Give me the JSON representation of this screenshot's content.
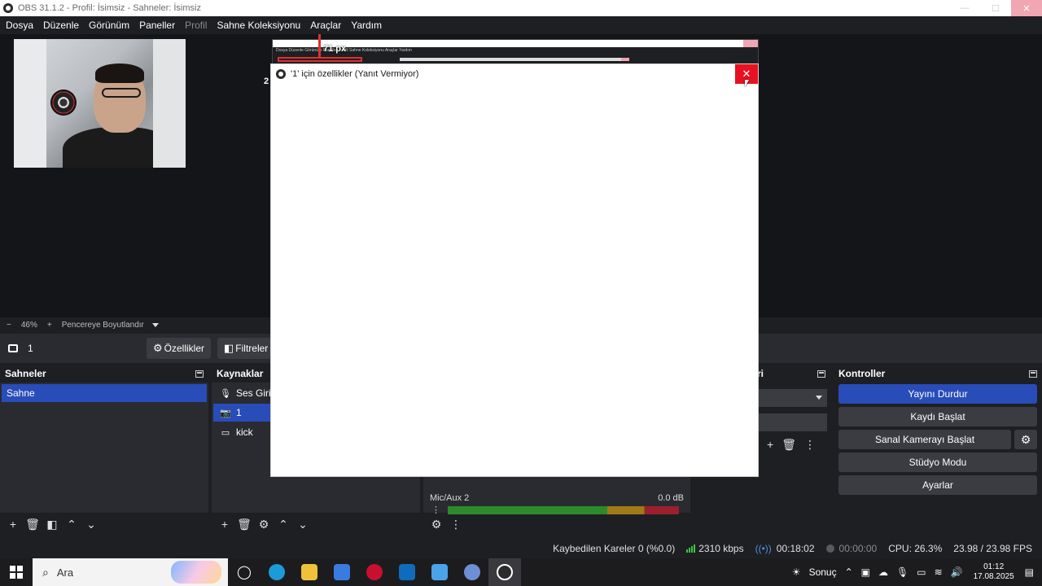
{
  "window": {
    "title": "OBS 31.1.2 - Profil: İsimsiz - Sahneler: İsimsiz"
  },
  "menu": {
    "items": [
      {
        "label": "Dosya"
      },
      {
        "label": "Düzenle"
      },
      {
        "label": "Görünüm"
      },
      {
        "label": "Paneller"
      },
      {
        "label": "Profil",
        "disabled": true
      },
      {
        "label": "Sahne Koleksiyonu"
      },
      {
        "label": "Araçlar"
      },
      {
        "label": "Yardım"
      }
    ]
  },
  "preview": {
    "measure_label": "71 px",
    "side_label": "2",
    "nested_menu": "Dosya   Düzenle   Görünüm   Paneller   Profil   Sahne Koleksiyonu   Araçlar   Yardım"
  },
  "zoom": {
    "minus": "−",
    "value": "46%",
    "plus": "+",
    "fit_label": "Pencereye Boyutlandır"
  },
  "context": {
    "source_name": "1",
    "properties_label": "Özellikler",
    "filters_label": "Filtreler"
  },
  "scenes": {
    "title": "Sahneler",
    "items": [
      "Sahne"
    ]
  },
  "sources": {
    "title": "Kaynaklar",
    "items": [
      {
        "label": "Ses Girişi",
        "icon": "microphone-icon"
      },
      {
        "label": "1",
        "icon": "camera-icon"
      },
      {
        "label": "kick",
        "icon": "monitor-icon"
      }
    ]
  },
  "mixer": {
    "track2_name": "Mic/Aux 2",
    "track2_db": "0.0 dB"
  },
  "transitions": {
    "title_fragment": "ri"
  },
  "controls": {
    "title": "Kontroller",
    "stop_stream": "Yayını Durdur",
    "start_record": "Kaydı Başlat",
    "start_virtualcam": "Sanal Kamerayı Başlat",
    "studio_mode": "Stüdyo Modu",
    "settings": "Ayarlar"
  },
  "status": {
    "dropped_frames": "Kaybedilen Kareler 0 (%0.0)",
    "bitrate": "2310 kbps",
    "stream_time": "00:18:02",
    "record_time": "00:00:00",
    "cpu": "CPU: 26.3%",
    "fps": "23.98 / 23.98 FPS"
  },
  "taskbar": {
    "search_placeholder": "Ara",
    "tray_label": "Sonuç",
    "time": "01:12",
    "date": "17.08.2025"
  },
  "dialog": {
    "title": "'1' için özellikler (Yanıt Vermiyor)",
    "close": "✕"
  },
  "colors": {
    "accent": "#284cb8",
    "close_red": "#e81123",
    "meter_green": "#2c8a2c",
    "meter_yellow": "#a07a18",
    "meter_red": "#9c1f2c"
  }
}
